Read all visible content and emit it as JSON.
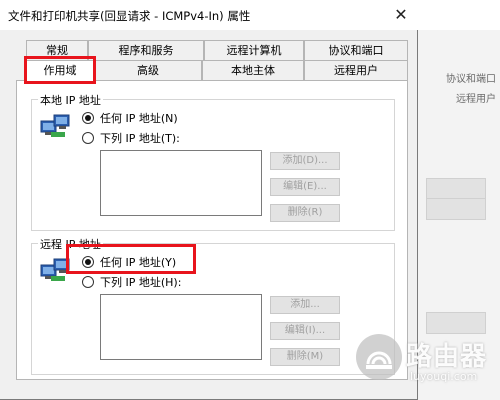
{
  "window": {
    "title": "文件和打印机共享(回显请求 - ICMPv4-In) 属性",
    "close_glyph": "✕"
  },
  "tabs_row1": [
    {
      "label": "常规"
    },
    {
      "label": "程序和服务"
    },
    {
      "label": "远程计算机"
    },
    {
      "label": "协议和端口"
    }
  ],
  "tabs_row2": [
    {
      "label": "作用域",
      "active": true
    },
    {
      "label": "高级"
    },
    {
      "label": "本地主体"
    },
    {
      "label": "远程用户"
    }
  ],
  "local_ip": {
    "legend": "本地 IP 地址",
    "icon": "network-computers-icon",
    "option_any": "任何 IP 地址(N)",
    "option_list": "下列 IP 地址(T):",
    "selected": "any",
    "buttons": {
      "add": "添加(D)...",
      "edit": "编辑(E)...",
      "remove": "删除(R)"
    }
  },
  "remote_ip": {
    "legend": "远程 IP 地址",
    "icon": "network-computers-icon",
    "option_any": "任何 IP 地址(Y)",
    "option_list": "下列 IP 地址(H):",
    "selected": "any",
    "buttons": {
      "add": "添加...",
      "edit": "编辑(I)...",
      "remove": "删除(M)"
    }
  },
  "background_window": {
    "text1": "协议和端口",
    "text2": "远程用户"
  },
  "watermark": {
    "icon": "router-logo-icon",
    "text": "路由器",
    "sub": "luyouqi.com"
  },
  "colors": {
    "highlight": "#e8141c"
  }
}
